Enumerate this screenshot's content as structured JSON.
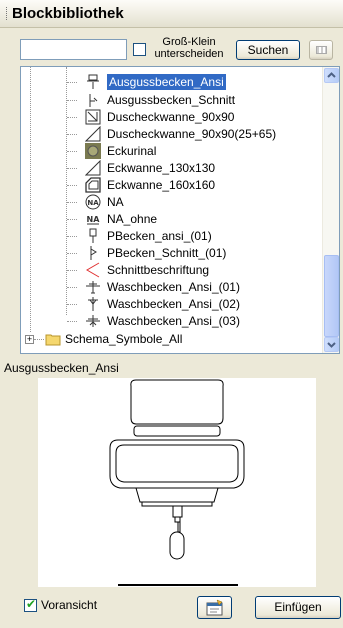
{
  "panel": {
    "title": "Blockbibliothek"
  },
  "search": {
    "value": "",
    "case_label": "Groß-Klein\nunterscheiden",
    "button": "Suchen"
  },
  "tree": {
    "items": [
      {
        "label": "Ausgussbecken_Ansi",
        "icon": "basin-front-icon",
        "selected": true
      },
      {
        "label": "Ausgussbecken_Schnitt",
        "icon": "basin-section-icon"
      },
      {
        "label": "Duscheckwanne_90x90",
        "icon": "shower-tray-icon"
      },
      {
        "label": "Duscheckwanne_90x90(25+65)",
        "icon": "shower-tray-diagonal-icon"
      },
      {
        "label": "Eckurinal",
        "icon": "corner-urinal-icon"
      },
      {
        "label": "Eckwanne_130x130",
        "icon": "corner-bath-icon"
      },
      {
        "label": "Eckwanne_160x160",
        "icon": "corner-bath-large-icon"
      },
      {
        "label": "NA",
        "icon": "na-circle-icon"
      },
      {
        "label": "NA_ohne",
        "icon": "na-text-icon"
      },
      {
        "label": "PBecken_ansi_(01)",
        "icon": "p-basin-front-icon"
      },
      {
        "label": "PBecken_Schnitt_(01)",
        "icon": "p-basin-section-icon"
      },
      {
        "label": "Schnittbeschriftung",
        "icon": "section-label-icon"
      },
      {
        "label": "Waschbecken_Ansi_(01)",
        "icon": "washbasin-01-icon"
      },
      {
        "label": "Waschbecken_Ansi_(02)",
        "icon": "washbasin-02-icon"
      },
      {
        "label": "Waschbecken_Ansi_(03)",
        "icon": "washbasin-03-icon"
      },
      {
        "label": "Schema_Symbole_All",
        "icon": "folder-icon",
        "folder": true
      }
    ]
  },
  "preview": {
    "name": "Ausgussbecken_Ansi",
    "toggle_label": "Voransicht",
    "toggle_checked": true
  },
  "buttons": {
    "insert": "Einfügen"
  },
  "colors": {
    "selection": "#316ac5",
    "panel_bg": "#ece9d8",
    "border": "#7f9db9"
  }
}
